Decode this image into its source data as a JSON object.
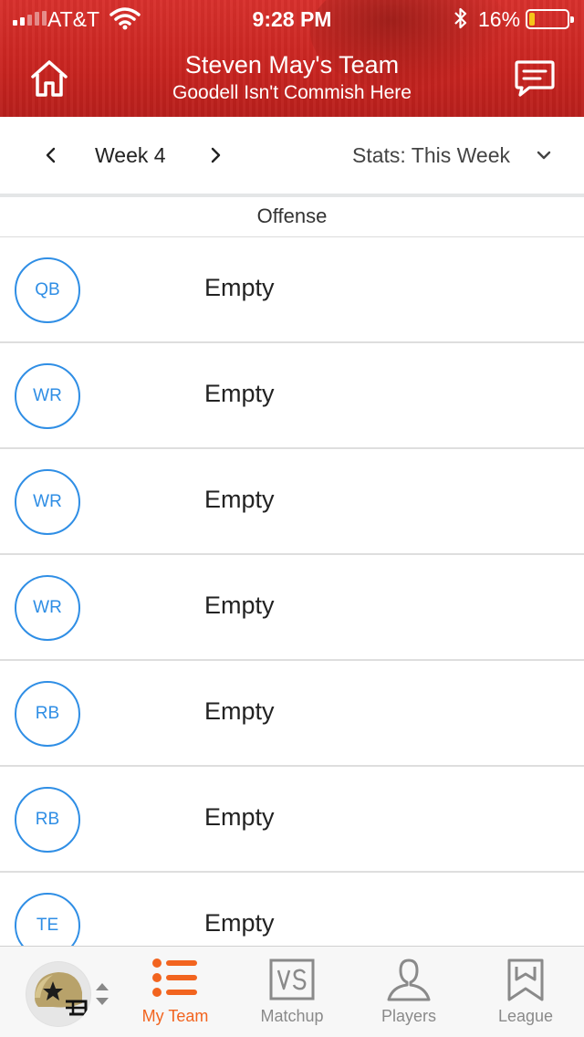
{
  "status_bar": {
    "carrier": "AT&T",
    "time": "9:28 PM",
    "battery_percent": "16%",
    "battery_level": 0.16
  },
  "header": {
    "title": "Steven May's Team",
    "subtitle": "Goodell Isn't Commish Here",
    "home_icon": "home-icon",
    "chat_icon": "chat-icon"
  },
  "week_bar": {
    "week_label": "Week 4",
    "stats_label": "Stats: This Week"
  },
  "section": {
    "title": "Offense"
  },
  "roster": [
    {
      "position": "QB",
      "player": "Empty"
    },
    {
      "position": "WR",
      "player": "Empty"
    },
    {
      "position": "WR",
      "player": "Empty"
    },
    {
      "position": "WR",
      "player": "Empty"
    },
    {
      "position": "RB",
      "player": "Empty"
    },
    {
      "position": "RB",
      "player": "Empty"
    },
    {
      "position": "TE",
      "player": "Empty"
    }
  ],
  "tabs": [
    {
      "label": "My Team",
      "icon": "list-icon",
      "active": true
    },
    {
      "label": "Matchup",
      "icon": "vs-icon",
      "active": false
    },
    {
      "label": "Players",
      "icon": "person-icon",
      "active": false
    },
    {
      "label": "League",
      "icon": "bookmark-icon",
      "active": false
    }
  ],
  "colors": {
    "header_red": "#c82420",
    "position_blue": "#2f8ee5",
    "active_orange": "#f2641f",
    "inactive_gray": "#8a8a8a"
  }
}
